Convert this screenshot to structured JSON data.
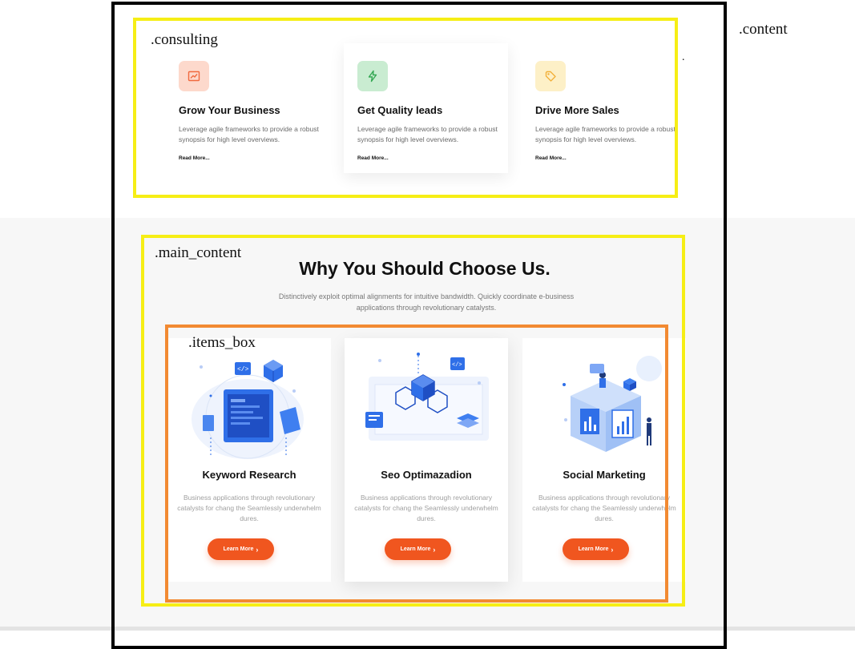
{
  "annotations": {
    "content": ".content",
    "dot": ".",
    "consulting": ".consulting",
    "main_content": ".main_content",
    "items_box": ".items_box"
  },
  "consulting": {
    "cards": [
      {
        "icon": "chart-icon",
        "icon_color": "#f06a3f",
        "icon_bg": "#fdd9cc",
        "title": "Grow Your Business",
        "desc": "Leverage agile frameworks to provide a robust synopsis for high level overviews.",
        "link": "Read More..."
      },
      {
        "icon": "lightning-icon",
        "icon_color": "#34a853",
        "icon_bg": "#c9ecd1",
        "title": "Get Quality leads",
        "desc": "Leverage agile frameworks to provide a robust synopsis for high level overviews.",
        "link": "Read More..."
      },
      {
        "icon": "tag-icon",
        "icon_color": "#f2b03a",
        "icon_bg": "#fdf0c7",
        "title": "Drive More Sales",
        "desc": "Leverage agile frameworks to provide a robust synopsis for high level overviews.",
        "link": "Read More..."
      }
    ]
  },
  "main": {
    "heading": "Why You Should Choose Us.",
    "intro": "Distinctively exploit optimal alignments for intuitive bandwidth. Quickly coordinate e-business applications through revolutionary catalysts.",
    "items": [
      {
        "illustration": "keyword-research-illustration",
        "title": "Keyword Research",
        "desc": "Business applications through revolutionary catalysts for chang the Seamlessly underwhelm dures.",
        "button": "Learn More"
      },
      {
        "illustration": "seo-illustration",
        "title": "Seo Optimazadion",
        "desc": "Business applications through revolutionary catalysts for chang the Seamlessly underwhelm dures.",
        "button": "Learn More"
      },
      {
        "illustration": "social-marketing-illustration",
        "title": "Social Marketing",
        "desc": "Business applications through revolutionary catalysts for chang the Seamlessly underwhelm dures.",
        "button": "Learn More"
      }
    ]
  },
  "colors": {
    "accent": "#f0561f",
    "annotation_yellow": "#f6ee15",
    "annotation_orange": "#f28a32",
    "illustration_blue": "#2f6fe8"
  }
}
